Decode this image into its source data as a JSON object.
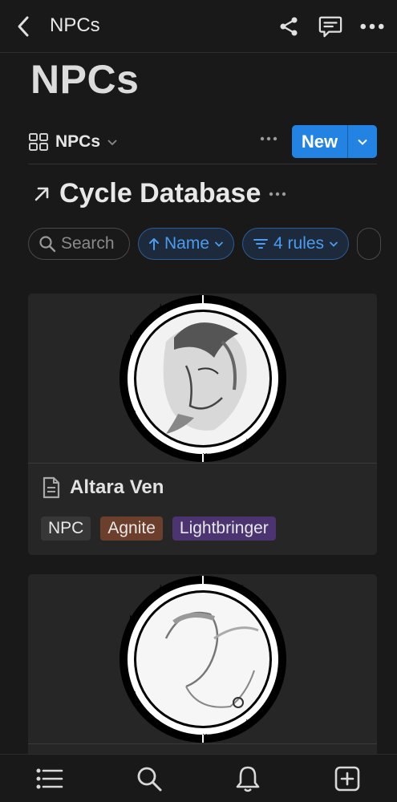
{
  "topbar": {
    "title": "NPCs"
  },
  "page": {
    "title": "NPCs"
  },
  "view": {
    "label": "NPCs",
    "new_label": "New"
  },
  "database": {
    "title": "Cycle Database"
  },
  "filters": {
    "search_label": "Search",
    "sort_label": "Name",
    "rules_label": "4 rules"
  },
  "cards": [
    {
      "name": "Altara Ven",
      "tags": [
        {
          "label": "NPC",
          "color": "#373737"
        },
        {
          "label": "Agnite",
          "color": "#6b3f2c"
        },
        {
          "label": "Lightbringer",
          "color": "#4b3470"
        }
      ]
    },
    {
      "name": "",
      "tags": []
    }
  ],
  "colors": {
    "accent": "#2383e2",
    "background": "#191919",
    "card": "#262626"
  },
  "icons": {
    "back": "chevron-left-icon",
    "share": "share-icon",
    "comments": "comment-icon",
    "more": "more-horizontal-icon",
    "gallery": "gallery-icon",
    "link": "arrow-up-right-icon",
    "page": "page-icon",
    "bottom": [
      "list-icon",
      "search-icon",
      "bell-icon",
      "new-page-icon"
    ]
  }
}
